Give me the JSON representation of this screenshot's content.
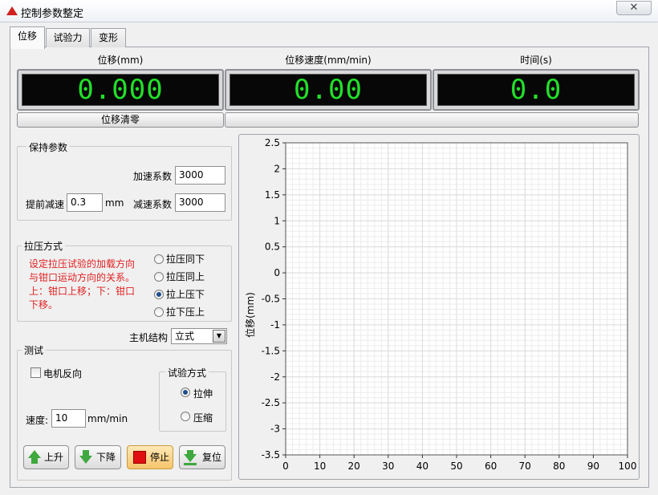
{
  "window": {
    "title": "控制参数整定",
    "close_glyph": "✕"
  },
  "tabs": [
    {
      "label": "位移"
    },
    {
      "label": "试验力"
    },
    {
      "label": "变形"
    }
  ],
  "displays": [
    {
      "label": "位移(mm)",
      "value": "0.000"
    },
    {
      "label": "位移速度(mm/min)",
      "value": "0.00"
    },
    {
      "label": "时间(s)",
      "value": "0.0"
    }
  ],
  "clear_button": "位移清零",
  "hold": {
    "title": "保持参数",
    "accel_label": "加速系数",
    "accel_value": "3000",
    "advance_label": "提前减速",
    "advance_value": "0.3",
    "advance_unit": "mm",
    "decel_label": "减速系数",
    "decel_value": "3000"
  },
  "mode": {
    "title": "拉压方式",
    "note": [
      "设定拉压试验的加载方向",
      "与钳口运动方向的关系。",
      "上：钳口上移；下：钳口",
      "下移。"
    ],
    "options": [
      "拉压同下",
      "拉压同上",
      "拉上压下",
      "拉下压上"
    ],
    "selected_index": 2,
    "note_color": "#e02020"
  },
  "structure": {
    "label": "主机结构",
    "value": "立式"
  },
  "test": {
    "title": "测试",
    "motor_reverse_label": "电机反向",
    "motor_reverse_checked": false,
    "method_title": "试验方式",
    "methods": [
      "拉伸",
      "压缩"
    ],
    "method_selected": 0,
    "speed_label": "速度:",
    "speed_value": "10",
    "speed_unit": "mm/min"
  },
  "buttons": {
    "up": "上升",
    "down": "下降",
    "stop": "停止",
    "reset": "复位"
  },
  "chart_data": {
    "type": "line",
    "ylabel": "位移(mm)",
    "xlabel": "",
    "xlim": [
      0,
      100
    ],
    "ylim": [
      -3.5,
      2.5
    ],
    "xticks": [
      0,
      10,
      20,
      30,
      40,
      50,
      60,
      70,
      80,
      90,
      100
    ],
    "yticks": [
      2.5,
      2,
      1.5,
      1,
      0.5,
      0,
      -0.5,
      -1,
      -1.5,
      -2,
      -2.5,
      -3,
      -3.5
    ],
    "grid": true,
    "series": []
  },
  "colors": {
    "display_digits": "#22e02a",
    "display_bg": "#070707",
    "stop_button": "#f7c46a",
    "arrow_green": "#3fa83f"
  }
}
